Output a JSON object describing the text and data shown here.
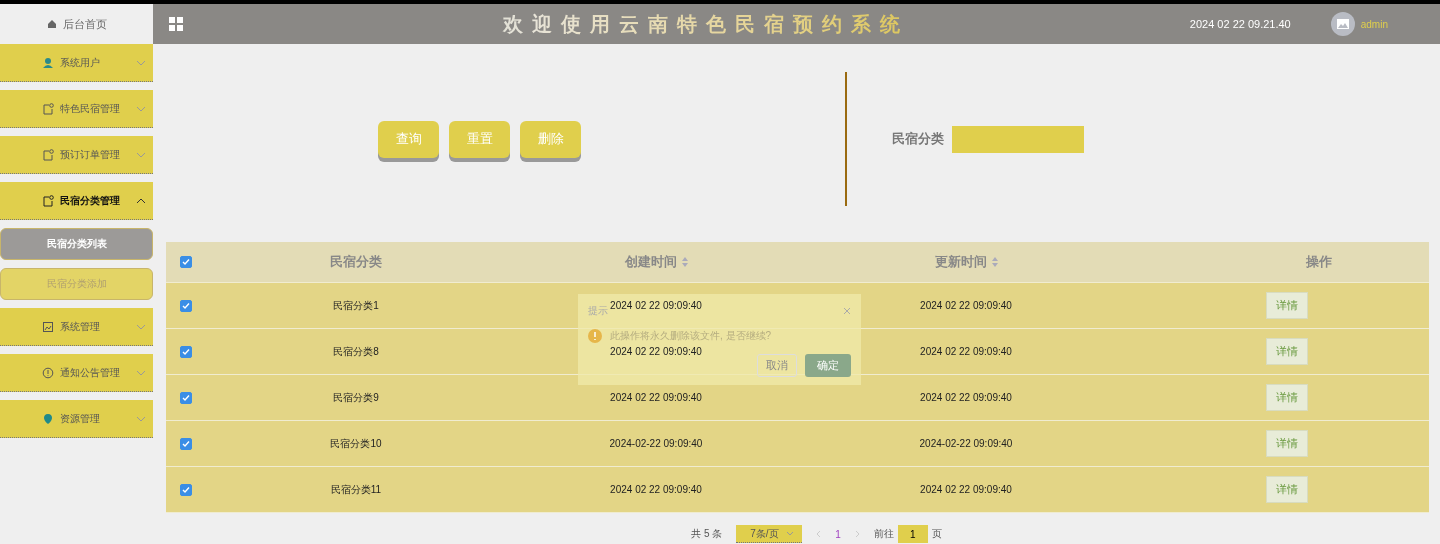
{
  "sidebar": {
    "home": "后台首页",
    "items": [
      {
        "label": "系统用户",
        "expanded": false
      },
      {
        "label": "特色民宿管理",
        "expanded": false
      },
      {
        "label": "预订订单管理",
        "expanded": false
      },
      {
        "label": "民宿分类管理",
        "expanded": true,
        "children": [
          {
            "label": "民宿分类列表",
            "selected": true
          },
          {
            "label": "民宿分类添加",
            "selected": false
          }
        ]
      },
      {
        "label": "系统管理",
        "expanded": false
      },
      {
        "label": "通知公告管理",
        "expanded": false
      },
      {
        "label": "资源管理",
        "expanded": false
      }
    ]
  },
  "header": {
    "title": "欢迎使用云南特色民宿预约系统",
    "datetime": "2024 02 22 09.21.40",
    "user": "admin"
  },
  "search": {
    "buttons": [
      "查询",
      "重置",
      "删除"
    ],
    "label": "民宿分类"
  },
  "table": {
    "all_checked": true,
    "columns": [
      {
        "label": "民宿分类",
        "sortable": false
      },
      {
        "label": "创建时间",
        "sortable": true
      },
      {
        "label": "更新时间",
        "sortable": true
      },
      {
        "label": "操作",
        "sortable": false
      }
    ],
    "rows": [
      {
        "checked": true,
        "name": "民宿分类1",
        "created": "2024 02 22 09:09:40",
        "updated": "2024 02 22 09:09:40",
        "action": "详情"
      },
      {
        "checked": true,
        "name": "民宿分类8",
        "created": "2024 02 22 09:09:40",
        "updated": "2024 02 22 09:09:40",
        "action": "详情"
      },
      {
        "checked": true,
        "name": "民宿分类9",
        "created": "2024 02 22 09:09:40",
        "updated": "2024 02 22 09:09:40",
        "action": "详情"
      },
      {
        "checked": true,
        "name": "民宿分类10",
        "created": "2024-02-22 09:09:40",
        "updated": "2024-02-22 09:09:40",
        "action": "详情"
      },
      {
        "checked": true,
        "name": "民宿分类11",
        "created": "2024 02 22 09:09:40",
        "updated": "2024 02 22 09:09:40",
        "action": "详情"
      }
    ]
  },
  "pagination": {
    "total": "共 5 条",
    "page_size": "7条/页",
    "pages": [
      {
        "label": "1",
        "selected": true
      }
    ],
    "goto": "前往",
    "goto_value": "1",
    "page_unit": "页"
  },
  "dialog": {
    "title": "提示",
    "message": "此操作将永久删除该文件, 是否继续?",
    "cancel": "取消",
    "confirm": "确定"
  }
}
